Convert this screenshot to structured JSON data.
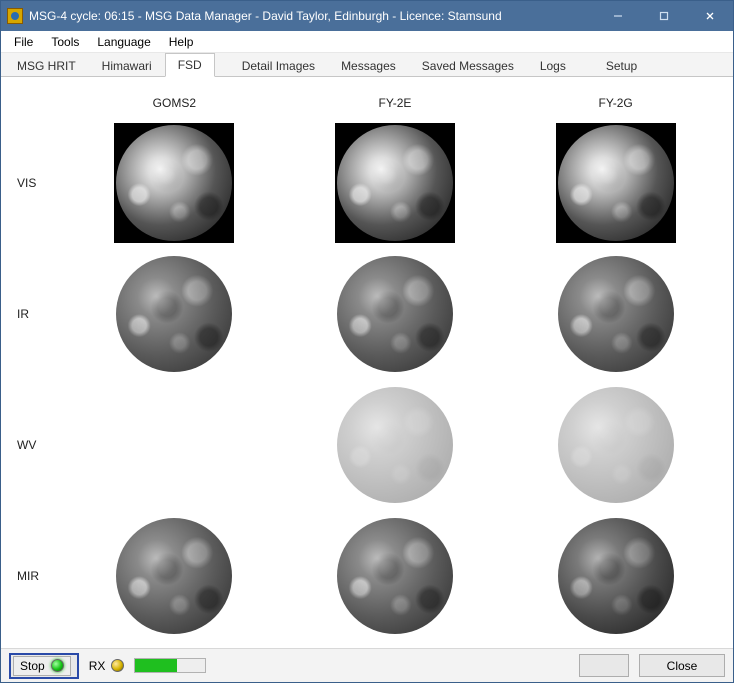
{
  "titlebar": {
    "text": "MSG-4 cycle: 06:15 - MSG Data Manager - David Taylor, Edinburgh - Licence: Stamsund"
  },
  "menu": {
    "file": "File",
    "tools": "Tools",
    "language": "Language",
    "help": "Help"
  },
  "tabs": {
    "msg_hrit": "MSG HRIT",
    "himawari": "Himawari",
    "fsd": "FSD",
    "detail_images": "Detail Images",
    "messages": "Messages",
    "saved_messages": "Saved Messages",
    "logs": "Logs",
    "setup": "Setup",
    "active": "FSD"
  },
  "columns": [
    "GOMS2",
    "FY-2E",
    "FY-2G"
  ],
  "rows": [
    "VIS",
    "IR",
    "WV",
    "MIR"
  ],
  "image_grid": [
    {
      "row": "VIS",
      "col": "GOMS2",
      "present": true,
      "style": "vis",
      "boxed": true
    },
    {
      "row": "VIS",
      "col": "FY-2E",
      "present": true,
      "style": "vis",
      "boxed": true
    },
    {
      "row": "VIS",
      "col": "FY-2G",
      "present": true,
      "style": "vis",
      "boxed": true
    },
    {
      "row": "IR",
      "col": "GOMS2",
      "present": true,
      "style": "ir",
      "boxed": false
    },
    {
      "row": "IR",
      "col": "FY-2E",
      "present": true,
      "style": "ir",
      "boxed": false
    },
    {
      "row": "IR",
      "col": "FY-2G",
      "present": true,
      "style": "ir",
      "boxed": false
    },
    {
      "row": "WV",
      "col": "GOMS2",
      "present": false,
      "style": "wv",
      "boxed": false
    },
    {
      "row": "WV",
      "col": "FY-2E",
      "present": true,
      "style": "wv",
      "boxed": false
    },
    {
      "row": "WV",
      "col": "FY-2G",
      "present": true,
      "style": "wv",
      "boxed": false
    },
    {
      "row": "MIR",
      "col": "GOMS2",
      "present": true,
      "style": "ir",
      "boxed": false
    },
    {
      "row": "MIR",
      "col": "FY-2E",
      "present": true,
      "style": "ir",
      "boxed": false
    },
    {
      "row": "MIR",
      "col": "FY-2G",
      "present": true,
      "style": "mir",
      "boxed": false
    }
  ],
  "status": {
    "stop_label": "Stop",
    "stop_led": "green",
    "rx_label": "RX",
    "rx_led": "amber",
    "progress_percent": 60,
    "close_label": "Close"
  }
}
